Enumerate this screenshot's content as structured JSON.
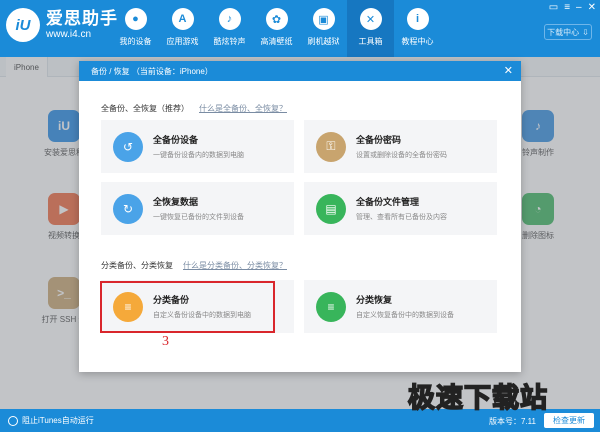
{
  "app": {
    "logo_mark": "iU",
    "name": "爱思助手",
    "url": "www.i4.cn"
  },
  "nav": [
    {
      "label": "我的设备",
      "icon": "apple-icon",
      "glyph": ""
    },
    {
      "label": "应用游戏",
      "icon": "app-store-icon",
      "glyph": "A"
    },
    {
      "label": "酷炫铃声",
      "icon": "bell-icon",
      "glyph": "🔔"
    },
    {
      "label": "高清壁纸",
      "icon": "flower-icon",
      "glyph": "✿"
    },
    {
      "label": "刷机越狱",
      "icon": "box-icon",
      "glyph": "▣"
    },
    {
      "label": "工具箱",
      "icon": "tools-icon",
      "glyph": "✕"
    },
    {
      "label": "教程中心",
      "icon": "info-icon",
      "glyph": "i"
    }
  ],
  "window": {
    "download_label": "下载中心"
  },
  "device_tab": "iPhone",
  "background_tools": [
    {
      "label": "安装爱思移",
      "color": "#1e88e5",
      "glyph": "iU"
    },
    {
      "label": "视频转换",
      "color": "#f0643a",
      "glyph": "▶"
    },
    {
      "label": "打开 SSH 通",
      "color": "#c8a46e",
      "glyph": ">_"
    },
    {
      "label": "铃声制作",
      "color": "#2f8ce0",
      "glyph": "🔔"
    },
    {
      "label": "删除图标",
      "color": "#38b55b",
      "glyph": "◔"
    }
  ],
  "modal": {
    "title": "备份 / 恢复 （当前设备：iPhone）",
    "section1": {
      "title": "全备份、全恢复（推荐）",
      "link": "什么是全备份、全恢复？"
    },
    "section2": {
      "title": "分类备份、分类恢复",
      "link": "什么是分类备份、分类恢复？"
    },
    "cards": [
      {
        "title": "全备份设备",
        "desc": "一键备份设备内的数据到电脑",
        "color": "#4aa3e8",
        "glyph": "↺"
      },
      {
        "title": "全备份密码",
        "desc": "设置或删除设备的全备份密码",
        "color": "#c8a46e",
        "glyph": "🔒"
      },
      {
        "title": "全恢复数据",
        "desc": "一键恢复已备份的文件到设备",
        "color": "#4aa3e8",
        "glyph": "↻"
      },
      {
        "title": "全备份文件管理",
        "desc": "管理、查看所有已备份及内容",
        "color": "#38b55b",
        "glyph": "▤"
      },
      {
        "title": "分类备份",
        "desc": "自定义备份设备中的数据到电脑",
        "color": "#f5a93a",
        "glyph": "≡"
      },
      {
        "title": "分类恢复",
        "desc": "自定义恢复备份中的数据到设备",
        "color": "#38b55b",
        "glyph": "≡"
      }
    ]
  },
  "annotation_number": "3",
  "status": {
    "itunes_label": "阻止iTunes自动运行",
    "version": "版本号：7.11",
    "update_label": "检查更新"
  },
  "watermark": "极速下载站"
}
